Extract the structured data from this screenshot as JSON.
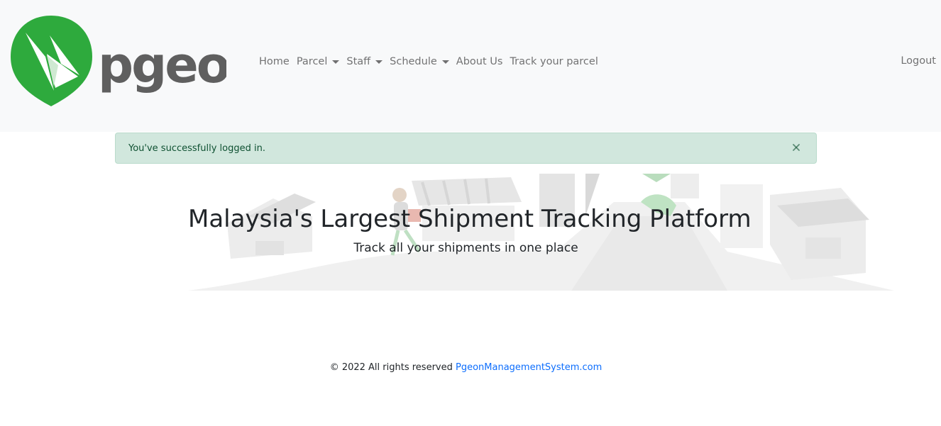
{
  "brand": {
    "name": "pgeon",
    "logo_icon": "pigeon-paper-plane-icon",
    "green": "#2eaa3d",
    "gray": "#5f5f5f"
  },
  "nav": {
    "items": [
      {
        "label": "Home",
        "dropdown": false
      },
      {
        "label": "Parcel",
        "dropdown": true
      },
      {
        "label": "Staff",
        "dropdown": true
      },
      {
        "label": "Schedule",
        "dropdown": true
      },
      {
        "label": "About Us",
        "dropdown": false
      },
      {
        "label": "Track your parcel",
        "dropdown": false
      }
    ],
    "logout_label": "Logout"
  },
  "alert": {
    "message": "You've successfully logged in.",
    "close_icon": "close-icon",
    "bg_color": "#d1e7dd",
    "text_color": "#0f5132"
  },
  "hero": {
    "title": "Malaysia's Largest Shipment Tracking Platform",
    "subtitle": "Track all your shipments in one place"
  },
  "footer": {
    "copyright": "© 2022 All rights reserved",
    "link_text": "PgeonManagementSystem.com",
    "link_color": "#0d6efd"
  }
}
